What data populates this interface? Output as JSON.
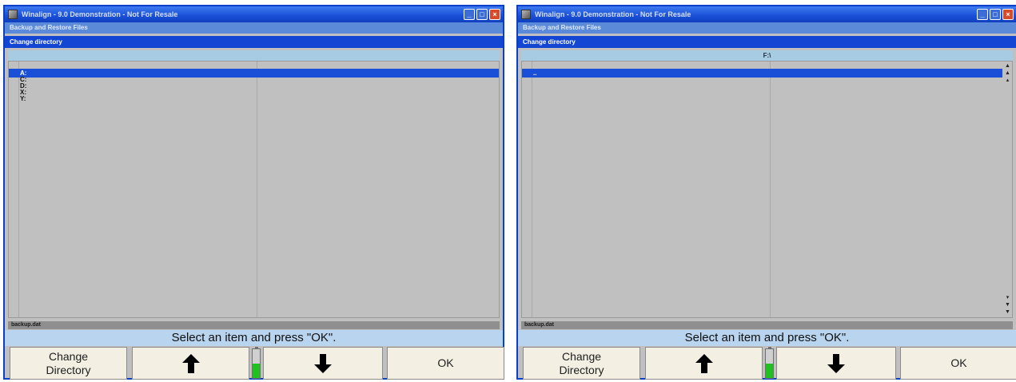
{
  "windows": [
    {
      "title": "Winalign - 9.0 Demonstration - Not For Resale",
      "subtitle": "Backup and Restore Files",
      "panel_header": "Change directory",
      "column_header": "",
      "rows": [
        "A:",
        "C:",
        "D:",
        "X:",
        "Y:"
      ],
      "selected_row": 0,
      "filename": "backup.dat",
      "status": "Select an item and press \"OK\".",
      "buttons": {
        "change_directory": "Change\nDirectory",
        "up": "⬆",
        "down": "⬇",
        "ok": "OK"
      },
      "battery_level": 0.5,
      "has_scrollbar": false
    },
    {
      "title": "Winalign - 9.0 Demonstration - Not For Resale",
      "subtitle": "Backup and Restore Files",
      "panel_header": "Change directory",
      "column_header": "F:\\",
      "rows": [
        ".."
      ],
      "selected_row": 0,
      "filename": "backup.dat",
      "status": "Select an item and press \"OK\".",
      "buttons": {
        "change_directory": "Change\nDirectory",
        "up": "⬆",
        "down": "⬇",
        "ok": "OK"
      },
      "battery_level": 0.5,
      "has_scrollbar": true
    }
  ],
  "colors": {
    "title_bar": "#1a4fd6",
    "panel_header": "#1446d4",
    "selection": "#1a50d8",
    "status_bar": "#b8d4ee",
    "button_face": "#f3efe2",
    "battery": "#21c021"
  },
  "icons": {
    "app": "app-icon",
    "minimize": "minimize-icon",
    "maximize": "maximize-icon",
    "close": "close-icon",
    "up": "arrow-up-icon",
    "down": "arrow-down-icon",
    "battery": "battery-icon"
  }
}
